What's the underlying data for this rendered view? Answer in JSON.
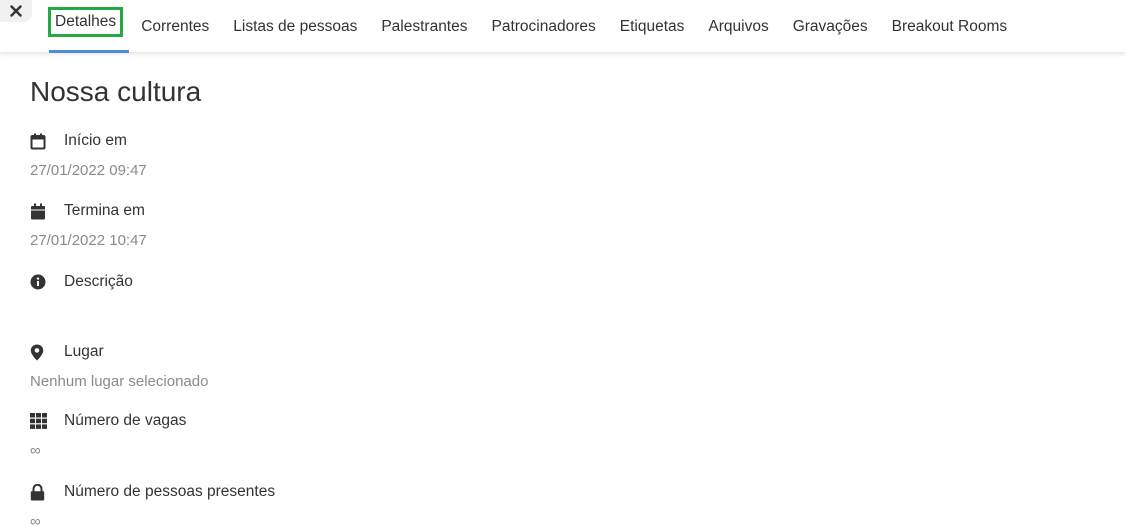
{
  "close_glyph": "✕",
  "tabs": [
    {
      "label": "Detalhes",
      "active": true
    },
    {
      "label": "Correntes"
    },
    {
      "label": "Listas de pessoas"
    },
    {
      "label": "Palestrantes"
    },
    {
      "label": "Patrocinadores"
    },
    {
      "label": "Etiquetas"
    },
    {
      "label": "Arquivos"
    },
    {
      "label": "Gravações"
    },
    {
      "label": "Breakout Rooms"
    }
  ],
  "page_title": "Nossa cultura",
  "fields": {
    "start": {
      "label": "Início em",
      "value": "27/01/2022 09:47",
      "icon": "calendar-outline-icon"
    },
    "end": {
      "label": "Termina em",
      "value": "27/01/2022 10:47",
      "icon": "calendar-filled-icon"
    },
    "description": {
      "label": "Descrição",
      "value": "",
      "icon": "info-circle-icon"
    },
    "place": {
      "label": "Lugar",
      "value": "Nenhum lugar selecionado",
      "icon": "map-pin-icon"
    },
    "slots": {
      "label": "Número de vagas",
      "value": "∞",
      "icon": "grid-icon"
    },
    "attendees": {
      "label": "Número de pessoas presentes",
      "value": "∞",
      "icon": "lock-icon"
    }
  },
  "colors": {
    "active_tab_underline": "#4a90d9",
    "active_tab_highlight": "#28a745",
    "muted_text": "#8a8a8a"
  }
}
